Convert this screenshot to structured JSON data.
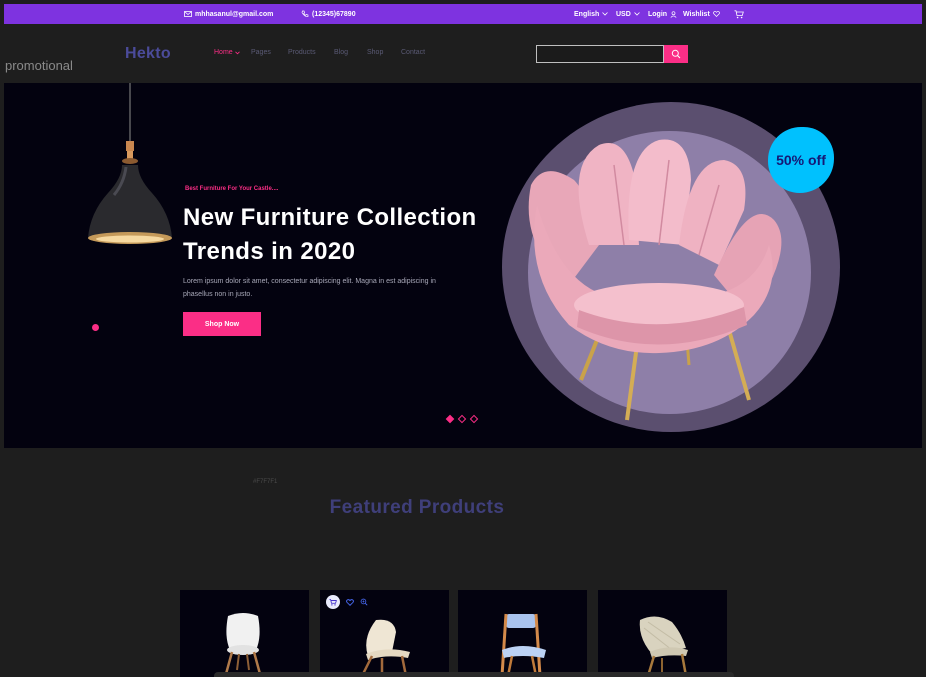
{
  "topbar": {
    "email": "mhhasanul@gmail.com",
    "phone": "(12345)67890",
    "language": "English",
    "currency": "USD",
    "login": "Login",
    "wishlist": "Wishlist"
  },
  "promo_label": "promotional",
  "brand": "Hekto",
  "nav": {
    "items": [
      "Home",
      "Pages",
      "Products",
      "Blog",
      "Shop",
      "Contact"
    ]
  },
  "search": {
    "placeholder": ""
  },
  "hero": {
    "tagline": "Best Furniture For Your Castle....",
    "headline": "New Furniture Collection Trends in 2020",
    "description": "Lorem ipsum dolor sit amet, consectetur adipiscing elit. Magna in est adipiscing in phasellus non in justo.",
    "cta": "Shop Now",
    "badge": "50% off"
  },
  "featured": {
    "hex_note": "#F7F7F1",
    "title": "Featured Products"
  },
  "colors": {
    "topbar": "#7E33E0",
    "accent": "#FB2E86",
    "brand": "#4B4B9A",
    "badge": "#00C1FE",
    "hero_bg": "#03020F"
  }
}
